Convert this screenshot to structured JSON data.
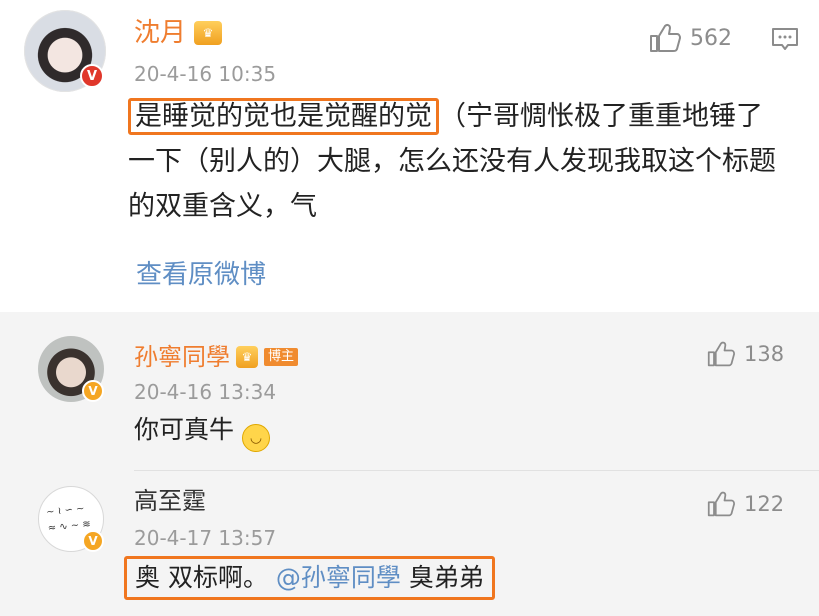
{
  "post": {
    "username": "沈月",
    "date": "20-4-16 10:35",
    "likes": "562",
    "highlight_text": "是睡觉的觉也是觉醒的觉",
    "body_text": "（宁哥惆怅极了重重地锤了一下（别人的）大腿，怎么还没有人发现我取这个标题的双重含义，气",
    "view_original": "查看原微博",
    "icons": {
      "like": "thumbs-up-icon",
      "comment": "comment-icon",
      "verified": "verified-v-icon",
      "member": "crown-icon"
    }
  },
  "replies": [
    {
      "username": "孙寧同學",
      "badge": "博主",
      "date": "20-4-16 13:34",
      "likes": "138",
      "text": "你可真牛",
      "emoji": "smile-emoji"
    },
    {
      "username": "高至霆",
      "date": "20-4-17 13:57",
      "likes": "122",
      "text_prefix": "奥 双标啊。",
      "mention": "@孙寧同學",
      "text_suffix": " 臭弟弟"
    }
  ],
  "colors": {
    "username": "#ef7d2f",
    "highlight_border": "#f0761f",
    "link": "#5f8ec4",
    "reply_bg": "#f4f4f4",
    "verified_red": "#e0372b",
    "verified_gold": "#f5a623"
  }
}
